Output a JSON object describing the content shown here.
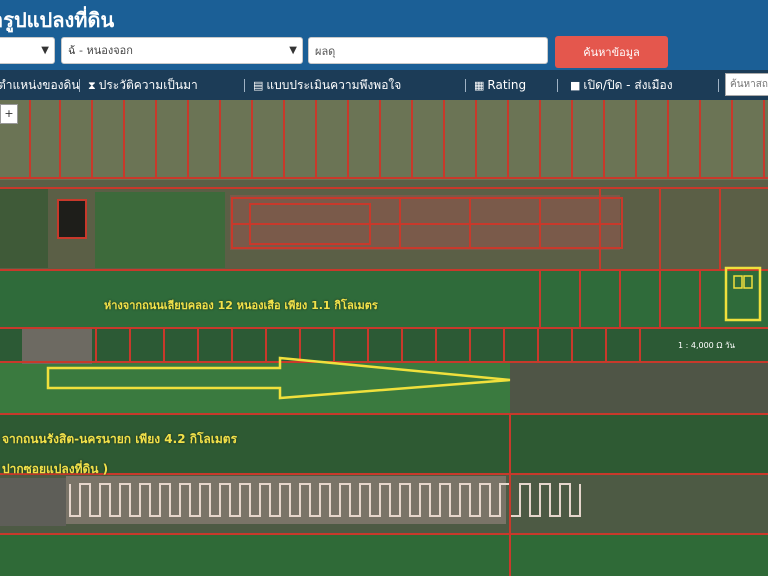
{
  "header": {
    "title": "ารูปแปลงที่ดิน",
    "province_select": {
      "value": ""
    },
    "district_select": {
      "value": "ฉ้ - หนองจอก"
    },
    "search_input": {
      "value": "ผลดุ"
    },
    "search_button": {
      "label": "ค้นหาข้อมูล"
    }
  },
  "menu": {
    "items": [
      {
        "label": "ตำแหน่งของดิน",
        "icon": ""
      },
      {
        "label": "ประวัติความเป็นมา",
        "icon": "hourglass-icon"
      },
      {
        "label": "แบบประเมินความพึงพอใจ",
        "icon": "clipboard-icon"
      },
      {
        "label": "Rating",
        "icon": "chart-icon"
      },
      {
        "label": "เปิด/ปิด - ส่งเมือง",
        "icon": "checkbox-icon"
      }
    ],
    "search_placeholder": "ค้นหาสถาน"
  },
  "map": {
    "zoom_label": "+",
    "annotations": {
      "distance_1": "ห่างจากถนนเลียบคลอง 12 หนองเสือ เพียง 1.1 กิโลเมตร",
      "distance_2": "จากถนนรังสิต-นครนายก เพียง 4.2 กิโลเมตร",
      "distance_3": "ปากซอยแปลงที่ดิน )"
    },
    "scale_text": "1 : 4,000 Ω วัน",
    "colors": {
      "parcel_outline": "#c8392b",
      "highlight": "#f0e03c",
      "field_green": "#2f6b3a",
      "field_dry": "#5c6b4a"
    }
  }
}
